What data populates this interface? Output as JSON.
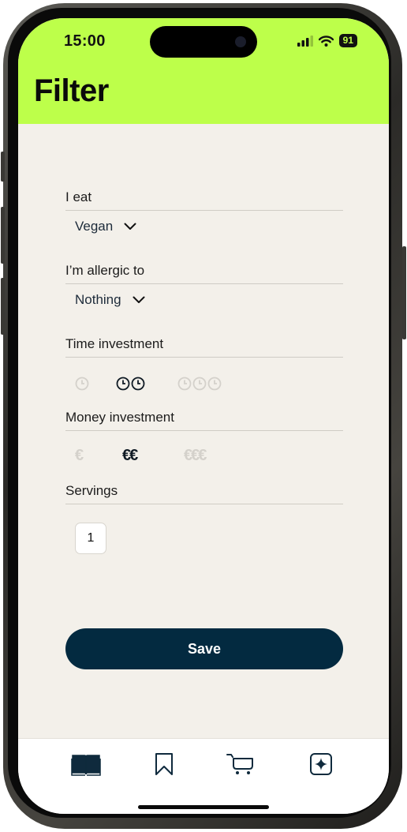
{
  "status_bar": {
    "time": "15:00",
    "battery": "91"
  },
  "header": {
    "title": "Filter"
  },
  "filters": {
    "eat": {
      "label": "I eat",
      "value": "Vegan"
    },
    "allergic": {
      "label": "I’m allergic to",
      "value": "Nothing"
    },
    "time": {
      "label": "Time investment",
      "selected_level": 2,
      "levels": 3
    },
    "money": {
      "label": "Money investment",
      "selected_level": 2,
      "options": [
        "€",
        "€€",
        "€€€"
      ]
    },
    "servings": {
      "label": "Servings",
      "value": "1"
    }
  },
  "save_label": "Save",
  "tabs": [
    {
      "icon": "book-icon",
      "active": true
    },
    {
      "icon": "bookmark-icon",
      "active": false
    },
    {
      "icon": "cart-icon",
      "active": false
    },
    {
      "icon": "sparkle-icon",
      "active": false
    }
  ],
  "colors": {
    "accent": "#bdff4a",
    "background": "#f3f0ea",
    "primary": "#032a40",
    "inactive": "#d4d1cb"
  }
}
